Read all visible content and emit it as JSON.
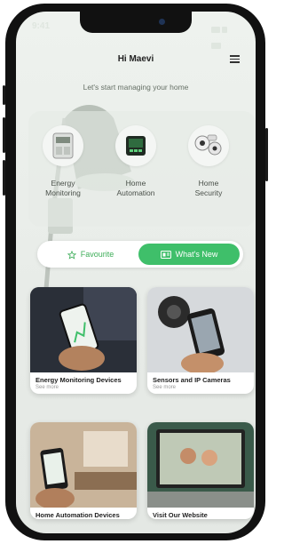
{
  "status": {
    "time": "9:41"
  },
  "header": {
    "greeting": "Hi Maevi",
    "subtitle": "Let's start managing your home"
  },
  "categories": [
    {
      "label": "Energy\nMonitoring",
      "icon": "energy-meter-icon"
    },
    {
      "label": "Home\nAutomation",
      "icon": "smart-switch-icon"
    },
    {
      "label": "Home\nSecurity",
      "icon": "security-camera-icon"
    }
  ],
  "segmented": {
    "favourite": "Favourite",
    "whats_new": "What's New",
    "active": "whats_new"
  },
  "cards": [
    {
      "title": "Energy Monitoring Devices",
      "link": "See more"
    },
    {
      "title": "Sensors and IP Cameras",
      "link": "See more"
    },
    {
      "title": "Home Automation Devices",
      "link": ""
    },
    {
      "title": "Visit Our Website",
      "link": ""
    }
  ],
  "colors": {
    "accent": "#3fbf6a",
    "accent_text": "#3fae5a",
    "background": "#e8ece8"
  }
}
